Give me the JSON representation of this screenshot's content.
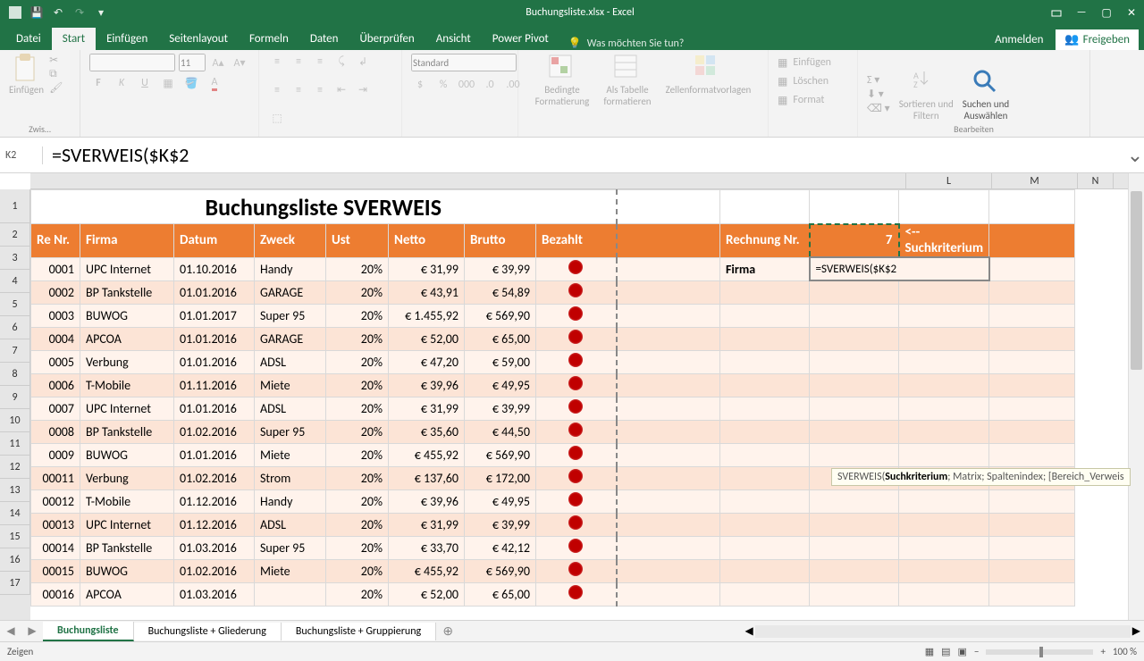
{
  "app": {
    "title": "Buchungsliste.xlsx - Excel",
    "signin": "Anmelden",
    "share": "Freigeben"
  },
  "tabs": [
    "Datei",
    "Start",
    "Einfügen",
    "Seitenlayout",
    "Formeln",
    "Daten",
    "Überprüfen",
    "Ansicht",
    "Power Pivot"
  ],
  "active_tab": "Start",
  "tellme": "Was möchten Sie tun?",
  "ribbon": {
    "paste": "Einfügen",
    "group_clipboard": "Zwis…",
    "font_size": "11",
    "number_format": "Standard",
    "cond_fmt": "Bedingte\nFormatierung",
    "as_table": "Als Tabelle\nformatieren",
    "cell_styles": "Zellenformatvorlagen",
    "insert": "Einfügen",
    "delete": "Löschen",
    "format": "Format",
    "sort": "Sortieren und\nFiltern",
    "find": "Suchen und\nAuswählen",
    "group_edit": "Bearbeiten"
  },
  "namebox": "K2",
  "formula": "=SVERWEIS($K$2",
  "columns_right": [
    "L",
    "M",
    "N"
  ],
  "rows": [
    "1",
    "2",
    "3",
    "4",
    "5",
    "6",
    "7",
    "8",
    "9",
    "10",
    "11",
    "12",
    "13",
    "14",
    "15",
    "16",
    "17"
  ],
  "list_title": "Buchungsliste SVERWEIS",
  "headers": [
    "Re Nr.",
    "Firma",
    "Datum",
    "Zweck",
    "Ust",
    "Netto",
    "Brutto",
    "Bezahlt"
  ],
  "data": [
    [
      "0001",
      "UPC Internet",
      "01.10.2016",
      "Handy",
      "20%",
      "€      31,99",
      "€ 39,99"
    ],
    [
      "0002",
      "BP Tankstelle",
      "01.01.2016",
      "GARAGE",
      "20%",
      "€      43,91",
      "€ 54,89"
    ],
    [
      "0003",
      "BUWOG",
      "01.01.2017",
      "Super 95",
      "20%",
      "€ 1.455,92",
      "€ 569,90"
    ],
    [
      "0004",
      "APCOA",
      "01.01.2016",
      "GARAGE",
      "20%",
      "€      52,00",
      "€ 65,00"
    ],
    [
      "0005",
      "Verbung",
      "01.01.2016",
      "ADSL",
      "20%",
      "€      47,20",
      "€ 59,00"
    ],
    [
      "0006",
      "T-Mobile",
      "01.11.2016",
      "Miete",
      "20%",
      "€      39,96",
      "€ 49,95"
    ],
    [
      "0007",
      "UPC Internet",
      "01.01.2016",
      "ADSL",
      "20%",
      "€      31,99",
      "€ 39,99"
    ],
    [
      "0008",
      "BP Tankstelle",
      "01.02.2016",
      "Super 95",
      "20%",
      "€      35,60",
      "€ 44,50"
    ],
    [
      "0009",
      "BUWOG",
      "01.01.2016",
      "Miete",
      "20%",
      "€    455,92",
      "€ 569,90"
    ],
    [
      "00011",
      "Verbung",
      "01.02.2016",
      "Strom",
      "20%",
      "€    137,60",
      "€ 172,00"
    ],
    [
      "00012",
      "T-Mobile",
      "01.12.2016",
      "Handy",
      "20%",
      "€      39,96",
      "€ 49,95"
    ],
    [
      "00013",
      "UPC Internet",
      "01.12.2016",
      "ADSL",
      "20%",
      "€      31,99",
      "€ 39,99"
    ],
    [
      "00014",
      "BP Tankstelle",
      "01.03.2016",
      "Super 95",
      "20%",
      "€      33,70",
      "€ 42,12"
    ],
    [
      "00015",
      "BUWOG",
      "01.02.2016",
      "Miete",
      "20%",
      "€    455,92",
      "€ 569,90"
    ],
    [
      "00016",
      "APCOA",
      "01.03.2016",
      "",
      "20%",
      "€      52,00",
      "€ 65,00"
    ]
  ],
  "lookup": {
    "label_rn": "Rechnung Nr.",
    "value_rn": "7",
    "note": "<-- Suchkriterium",
    "label_firma": "Firma",
    "editing": "=SVERWEIS($K$2",
    "tooltip_fn": "SVERWEIS(",
    "tooltip_bold": "Suchkriterium",
    "tooltip_rest": "; Matrix; Spaltenindex; [Bereich_Verweis"
  },
  "sheets": [
    "Buchungsliste",
    "Buchungsliste + Gliederung",
    "Buchungsliste + Gruppierung"
  ],
  "active_sheet": "Buchungsliste",
  "status": "Zeigen",
  "zoom": "100 %"
}
